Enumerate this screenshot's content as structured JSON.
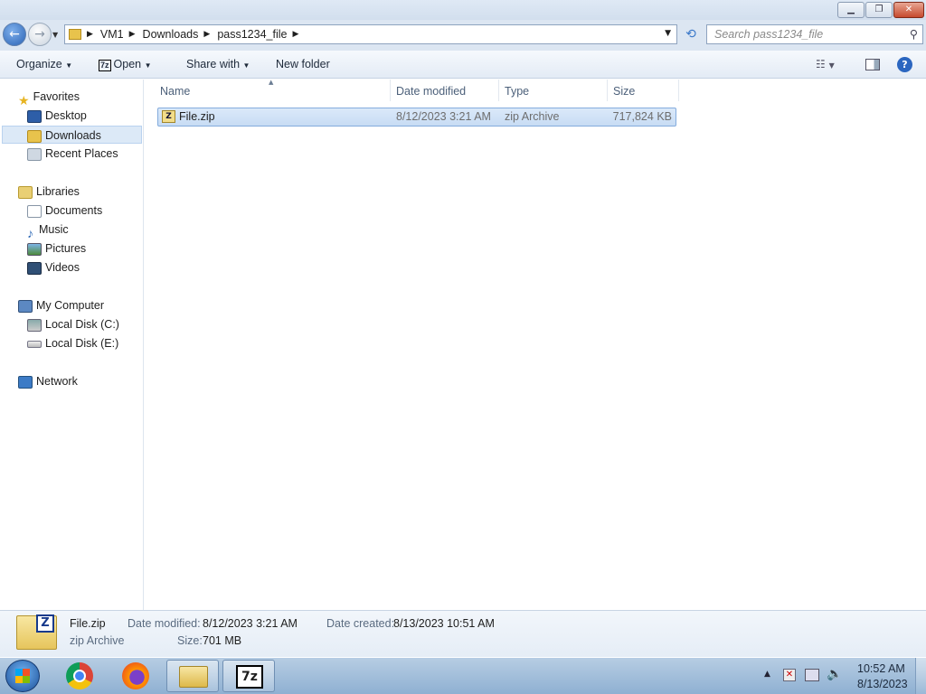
{
  "window": {
    "buttons": {
      "minimize": "▁",
      "maximize": "❐",
      "close": "✕"
    }
  },
  "nav": {
    "back_icon": "arrow-left-icon",
    "forward_icon": "arrow-right-icon",
    "breadcrumbs": [
      "VM1",
      "Downloads",
      "pass1234_file"
    ],
    "search_placeholder": "Search pass1234_file"
  },
  "toolbar": {
    "organize": "Organize",
    "open": "Open",
    "share_with": "Share with",
    "new_folder": "New folder"
  },
  "sidebar": {
    "favorites": {
      "title": "Favorites",
      "items": [
        "Desktop",
        "Downloads",
        "Recent Places"
      ]
    },
    "libraries": {
      "title": "Libraries",
      "items": [
        "Documents",
        "Music",
        "Pictures",
        "Videos"
      ]
    },
    "computer": {
      "title": "My Computer",
      "items": [
        "Local Disk (C:)",
        "Local Disk (E:)"
      ]
    },
    "network": {
      "title": "Network"
    },
    "selected": "Downloads"
  },
  "columns": {
    "name": "Name",
    "date_modified": "Date modified",
    "type": "Type",
    "size": "Size"
  },
  "files": [
    {
      "name": "File.zip",
      "date_modified": "8/12/2023 3:21 AM",
      "type": "zip Archive",
      "size": "717,824 KB"
    }
  ],
  "details": {
    "name": "File.zip",
    "type": "zip Archive",
    "date_modified_label": "Date modified:",
    "date_modified": "8/12/2023 3:21 AM",
    "size_label": "Size:",
    "size": "701 MB",
    "date_created_label": "Date created:",
    "date_created": "8/13/2023 10:51 AM"
  },
  "taskbar": {
    "time": "10:52 AM",
    "date": "8/13/2023",
    "seven_zip_label": "7z"
  },
  "colors": {
    "accent": "#3a78c9",
    "selection": "#c8dcf4",
    "toolbar": "#e3ebf5"
  }
}
